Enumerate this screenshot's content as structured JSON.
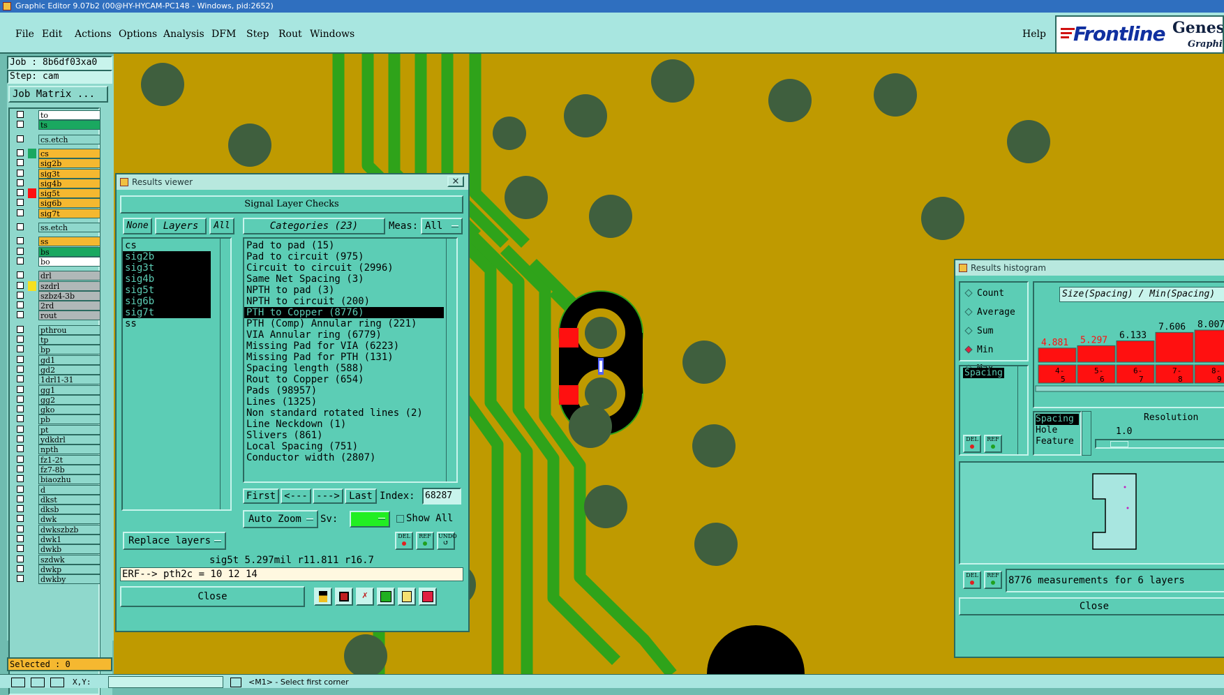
{
  "window_title": "Graphic Editor 9.07b2 (00@HY-HYCAM-PC148 - Windows, pid:2652)",
  "menu": {
    "file": "File",
    "edit": "Edit",
    "actions": "Actions",
    "options": "Options",
    "analysis": "Analysis",
    "dfm": "DFM",
    "step": "Step",
    "rout": "Rout",
    "windows": "Windows",
    "help": "Help"
  },
  "logo": {
    "brand": "Frontline",
    "product": "Genesis",
    "sub": "Graphic"
  },
  "left_panel": {
    "job": "Job : 8b6df03xa0",
    "step": "Step: cam",
    "job_matrix": "Job Matrix ...",
    "selected": "Selected : 0"
  },
  "layers": [
    {
      "name": "to",
      "color": "#ffffff"
    },
    {
      "name": "ts",
      "color": "#1aa860"
    },
    {
      "name": "cs.etch",
      "color": "#8fd8cc"
    },
    {
      "name": "cs",
      "color": "#f5b830"
    },
    {
      "name": "sig2b",
      "color": "#f5b830"
    },
    {
      "name": "sig3t",
      "color": "#f5b830"
    },
    {
      "name": "sig4b",
      "color": "#f5b830"
    },
    {
      "name": "sig5t",
      "color": "#f5b830"
    },
    {
      "name": "sig6b",
      "color": "#f5b830"
    },
    {
      "name": "sig7t",
      "color": "#f5b830"
    },
    {
      "name": "ss.etch",
      "color": "#8fd8cc"
    },
    {
      "name": "ss",
      "color": "#f5b830"
    },
    {
      "name": "bs",
      "color": "#1aa860"
    },
    {
      "name": "bo",
      "color": "#ffffff"
    },
    {
      "name": "drl",
      "color": "#b0b8b8"
    },
    {
      "name": "szdrl",
      "color": "#b0b8b8"
    },
    {
      "name": "szbz4-3b",
      "color": "#b0b8b8"
    },
    {
      "name": "2rd",
      "color": "#b0b8b8"
    },
    {
      "name": "rout",
      "color": "#b0b8b8"
    },
    {
      "name": "pthrou",
      "color": "#8fd8cc"
    },
    {
      "name": "tp",
      "color": "#8fd8cc"
    },
    {
      "name": "bp",
      "color": "#8fd8cc"
    },
    {
      "name": "gd1",
      "color": "#8fd8cc"
    },
    {
      "name": "gd2",
      "color": "#8fd8cc"
    },
    {
      "name": "1drl1-31",
      "color": "#8fd8cc"
    },
    {
      "name": "gg1",
      "color": "#8fd8cc"
    },
    {
      "name": "gg2",
      "color": "#8fd8cc"
    },
    {
      "name": "gko",
      "color": "#8fd8cc"
    },
    {
      "name": "pb",
      "color": "#8fd8cc"
    },
    {
      "name": "pt",
      "color": "#8fd8cc"
    },
    {
      "name": "ydkdrl",
      "color": "#8fd8cc"
    },
    {
      "name": "npth",
      "color": "#8fd8cc"
    },
    {
      "name": "fz1-2t",
      "color": "#8fd8cc"
    },
    {
      "name": "fz7-8b",
      "color": "#8fd8cc"
    },
    {
      "name": "biaozhu",
      "color": "#8fd8cc"
    },
    {
      "name": "d",
      "color": "#8fd8cc"
    },
    {
      "name": "dkst",
      "color": "#8fd8cc"
    },
    {
      "name": "dksb",
      "color": "#8fd8cc"
    },
    {
      "name": "dwk",
      "color": "#8fd8cc"
    },
    {
      "name": "dwkszbzb",
      "color": "#8fd8cc"
    },
    {
      "name": "dwk1",
      "color": "#8fd8cc"
    },
    {
      "name": "dwkb",
      "color": "#8fd8cc"
    },
    {
      "name": "szdwk",
      "color": "#8fd8cc"
    },
    {
      "name": "dwkp",
      "color": "#8fd8cc"
    },
    {
      "name": "dwkby",
      "color": "#8fd8cc"
    }
  ],
  "results_viewer": {
    "title": "Results viewer",
    "header": "Signal Layer Checks",
    "none": "None",
    "layers_btn": "Layers",
    "all": "All",
    "categories_btn": "Categories (23)",
    "meas_label": "Meas:",
    "meas_value": "All",
    "layer_list": [
      "cs",
      "sig2b",
      "sig3t",
      "sig4b",
      "sig5t",
      "sig6b",
      "sig7t",
      "ss"
    ],
    "categories": [
      "Pad to pad (15)",
      "Pad to circuit (975)",
      "Circuit to circuit (2996)",
      "Same Net Spacing (3)",
      "NPTH to pad (3)",
      "NPTH to circuit (200)",
      "PTH to Copper (8776)",
      "PTH (Comp) Annular ring (221)",
      "VIA Annular ring (6779)",
      "Missing Pad for VIA (6223)",
      "Missing Pad for PTH (131)",
      "Spacing length (588)",
      "Rout to Copper (654)",
      "Pads (98957)",
      "Lines (1325)",
      "Non standard rotated lines (2)",
      "Line Neckdown (1)",
      "Slivers (861)",
      "Local Spacing (751)",
      "Conductor width (2807)"
    ],
    "first": "First",
    "prev": "<---",
    "next": "--->",
    "last": "Last",
    "index_label": "Index:",
    "index_value": "68287",
    "auto_zoom": "Auto Zoom",
    "sv_label": "Sv:",
    "show_all": "Show All",
    "replace_layers": "Replace layers",
    "del": "DEL",
    "ref": "REF",
    "undo": "UNDO",
    "status": "sig5t 5.297mil  r11.811  r16.7",
    "erf": "ERF--> pth2c = 10 12 14",
    "close": "Close"
  },
  "histogram": {
    "title": "Results histogram",
    "radios": [
      "Count",
      "Average",
      "Sum",
      "Min",
      "Max"
    ],
    "selected_radio": "Min",
    "header": "Size(Spacing) / Min(Spacing)",
    "measure_list": [
      "Spacing"
    ],
    "bars": [
      {
        "label": "4.881",
        "range": "4-\n5",
        "value": 4.881
      },
      {
        "label": "5.297",
        "range": "5-\n6",
        "value": 5.297
      },
      {
        "label": "6.133",
        "range": "6-\n7",
        "value": 6.133
      },
      {
        "label": "7.606",
        "range": "7-\n8",
        "value": 7.606
      },
      {
        "label": "8.007",
        "range": "8-\n9",
        "value": 8.007
      }
    ],
    "size_list": [
      "Spacing",
      "Hole",
      "Feature"
    ],
    "resolution_label": "Resolution",
    "resolution_value": "1.0",
    "summary": "8776 measurements for 6 layers",
    "close": "Close"
  },
  "statusbar": {
    "xy": "X,Y:",
    "prompt": "<M1> - Select first corner"
  },
  "colors": {
    "background": "#bf9a00",
    "trace": "#2fa31a",
    "pad": "#3f5f3e",
    "highlight": "#ff0000",
    "window": "#5ccdb5"
  }
}
